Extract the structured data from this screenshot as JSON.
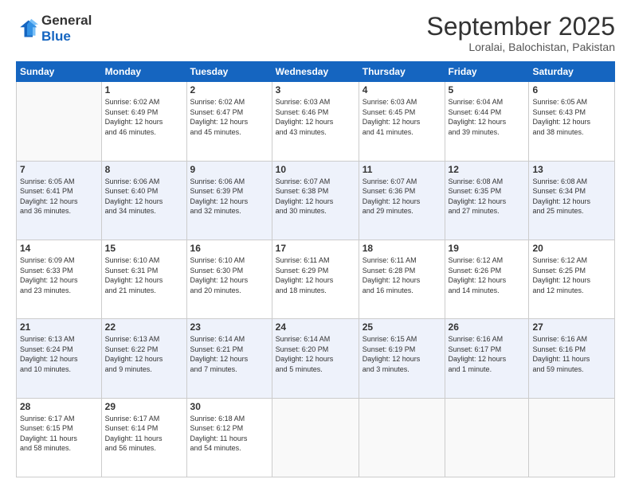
{
  "logo": {
    "line1": "General",
    "line2": "Blue"
  },
  "title": "September 2025",
  "location": "Loralai, Balochistan, Pakistan",
  "days_header": [
    "Sunday",
    "Monday",
    "Tuesday",
    "Wednesday",
    "Thursday",
    "Friday",
    "Saturday"
  ],
  "weeks": [
    [
      {
        "num": "",
        "info": ""
      },
      {
        "num": "1",
        "info": "Sunrise: 6:02 AM\nSunset: 6:49 PM\nDaylight: 12 hours\nand 46 minutes."
      },
      {
        "num": "2",
        "info": "Sunrise: 6:02 AM\nSunset: 6:47 PM\nDaylight: 12 hours\nand 45 minutes."
      },
      {
        "num": "3",
        "info": "Sunrise: 6:03 AM\nSunset: 6:46 PM\nDaylight: 12 hours\nand 43 minutes."
      },
      {
        "num": "4",
        "info": "Sunrise: 6:03 AM\nSunset: 6:45 PM\nDaylight: 12 hours\nand 41 minutes."
      },
      {
        "num": "5",
        "info": "Sunrise: 6:04 AM\nSunset: 6:44 PM\nDaylight: 12 hours\nand 39 minutes."
      },
      {
        "num": "6",
        "info": "Sunrise: 6:05 AM\nSunset: 6:43 PM\nDaylight: 12 hours\nand 38 minutes."
      }
    ],
    [
      {
        "num": "7",
        "info": "Sunrise: 6:05 AM\nSunset: 6:41 PM\nDaylight: 12 hours\nand 36 minutes."
      },
      {
        "num": "8",
        "info": "Sunrise: 6:06 AM\nSunset: 6:40 PM\nDaylight: 12 hours\nand 34 minutes."
      },
      {
        "num": "9",
        "info": "Sunrise: 6:06 AM\nSunset: 6:39 PM\nDaylight: 12 hours\nand 32 minutes."
      },
      {
        "num": "10",
        "info": "Sunrise: 6:07 AM\nSunset: 6:38 PM\nDaylight: 12 hours\nand 30 minutes."
      },
      {
        "num": "11",
        "info": "Sunrise: 6:07 AM\nSunset: 6:36 PM\nDaylight: 12 hours\nand 29 minutes."
      },
      {
        "num": "12",
        "info": "Sunrise: 6:08 AM\nSunset: 6:35 PM\nDaylight: 12 hours\nand 27 minutes."
      },
      {
        "num": "13",
        "info": "Sunrise: 6:08 AM\nSunset: 6:34 PM\nDaylight: 12 hours\nand 25 minutes."
      }
    ],
    [
      {
        "num": "14",
        "info": "Sunrise: 6:09 AM\nSunset: 6:33 PM\nDaylight: 12 hours\nand 23 minutes."
      },
      {
        "num": "15",
        "info": "Sunrise: 6:10 AM\nSunset: 6:31 PM\nDaylight: 12 hours\nand 21 minutes."
      },
      {
        "num": "16",
        "info": "Sunrise: 6:10 AM\nSunset: 6:30 PM\nDaylight: 12 hours\nand 20 minutes."
      },
      {
        "num": "17",
        "info": "Sunrise: 6:11 AM\nSunset: 6:29 PM\nDaylight: 12 hours\nand 18 minutes."
      },
      {
        "num": "18",
        "info": "Sunrise: 6:11 AM\nSunset: 6:28 PM\nDaylight: 12 hours\nand 16 minutes."
      },
      {
        "num": "19",
        "info": "Sunrise: 6:12 AM\nSunset: 6:26 PM\nDaylight: 12 hours\nand 14 minutes."
      },
      {
        "num": "20",
        "info": "Sunrise: 6:12 AM\nSunset: 6:25 PM\nDaylight: 12 hours\nand 12 minutes."
      }
    ],
    [
      {
        "num": "21",
        "info": "Sunrise: 6:13 AM\nSunset: 6:24 PM\nDaylight: 12 hours\nand 10 minutes."
      },
      {
        "num": "22",
        "info": "Sunrise: 6:13 AM\nSunset: 6:22 PM\nDaylight: 12 hours\nand 9 minutes."
      },
      {
        "num": "23",
        "info": "Sunrise: 6:14 AM\nSunset: 6:21 PM\nDaylight: 12 hours\nand 7 minutes."
      },
      {
        "num": "24",
        "info": "Sunrise: 6:14 AM\nSunset: 6:20 PM\nDaylight: 12 hours\nand 5 minutes."
      },
      {
        "num": "25",
        "info": "Sunrise: 6:15 AM\nSunset: 6:19 PM\nDaylight: 12 hours\nand 3 minutes."
      },
      {
        "num": "26",
        "info": "Sunrise: 6:16 AM\nSunset: 6:17 PM\nDaylight: 12 hours\nand 1 minute."
      },
      {
        "num": "27",
        "info": "Sunrise: 6:16 AM\nSunset: 6:16 PM\nDaylight: 11 hours\nand 59 minutes."
      }
    ],
    [
      {
        "num": "28",
        "info": "Sunrise: 6:17 AM\nSunset: 6:15 PM\nDaylight: 11 hours\nand 58 minutes."
      },
      {
        "num": "29",
        "info": "Sunrise: 6:17 AM\nSunset: 6:14 PM\nDaylight: 11 hours\nand 56 minutes."
      },
      {
        "num": "30",
        "info": "Sunrise: 6:18 AM\nSunset: 6:12 PM\nDaylight: 11 hours\nand 54 minutes."
      },
      {
        "num": "",
        "info": ""
      },
      {
        "num": "",
        "info": ""
      },
      {
        "num": "",
        "info": ""
      },
      {
        "num": "",
        "info": ""
      }
    ]
  ]
}
